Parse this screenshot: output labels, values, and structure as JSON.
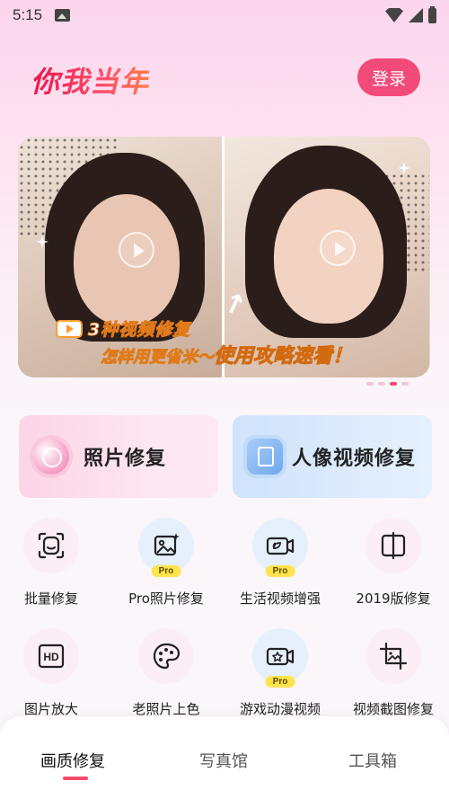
{
  "status_bar": {
    "time": "5:15"
  },
  "header": {
    "logo_text": "你我当年",
    "login_label": "登录"
  },
  "banner": {
    "caption_line1": "3种视频修复",
    "caption_line2a": "怎样用更省米～",
    "caption_line2b": "使用攻略速看！",
    "dots_count": 4,
    "active_dot": 2
  },
  "big_cards": {
    "photo": {
      "label": "照片修复"
    },
    "video": {
      "label": "人像视频修复"
    }
  },
  "grid_items": [
    {
      "label": "批量修复",
      "icon": "smiley-frame-icon",
      "pro": false
    },
    {
      "label": "Pro照片修复",
      "icon": "image-sparkle-icon",
      "pro": true
    },
    {
      "label": "生活视频增强",
      "icon": "video-leaf-icon",
      "pro": true
    },
    {
      "label": "2019版修复",
      "icon": "split-frame-icon",
      "pro": false
    },
    {
      "label": "图片放大",
      "icon": "hd-icon",
      "pro": false
    },
    {
      "label": "老照片上色",
      "icon": "palette-icon",
      "pro": false
    },
    {
      "label": "游戏动漫视频",
      "icon": "video-star-icon",
      "pro": true
    },
    {
      "label": "视频截图修复",
      "icon": "crop-image-icon",
      "pro": false
    }
  ],
  "pro_tag": "Pro",
  "tabs": [
    {
      "label": "画质修复",
      "active": true
    },
    {
      "label": "写真馆",
      "active": false
    },
    {
      "label": "工具箱",
      "active": false
    }
  ],
  "colors": {
    "accent": "#f24a79",
    "pro_yellow": "#ffe44d"
  }
}
